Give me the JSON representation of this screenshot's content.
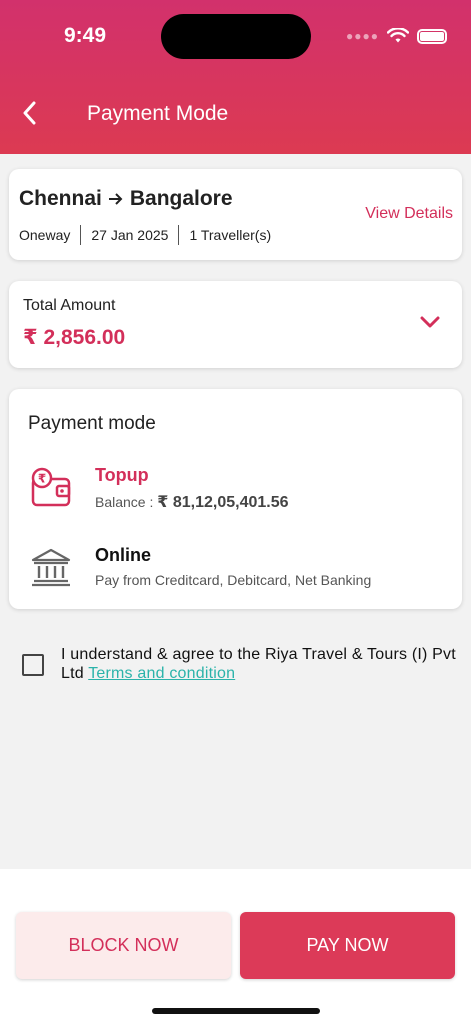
{
  "status_bar": {
    "time": "9:49"
  },
  "header": {
    "title": "Payment Mode"
  },
  "trip": {
    "from": "Chennai",
    "to": "Bangalore",
    "trip_type": "Oneway",
    "date": "27 Jan 2025",
    "travellers": "1 Traveller(s)",
    "view_details_label": "View Details"
  },
  "amount": {
    "label": "Total Amount",
    "value": "₹ 2,856.00"
  },
  "payment_mode": {
    "title": "Payment mode",
    "options": [
      {
        "name": "Topup",
        "balance_label": "Balance :",
        "balance_value": "₹ 81,12,05,401.56",
        "icon": "wallet-icon"
      },
      {
        "name": "Online",
        "sub": "Pay from Creditcard, Debitcard, Net Banking",
        "icon": "bank-icon"
      }
    ]
  },
  "agreement": {
    "text": "I understand & agree to the Riya Travel & Tours (I) Pvt Ltd ",
    "link_label": "Terms and condition",
    "checked": false
  },
  "actions": {
    "block_label": "BLOCK NOW",
    "pay_label": "PAY NOW"
  },
  "colors": {
    "brand": "#d32f5a",
    "header_top": "#d2316c",
    "header_bottom": "#dc3a52",
    "link": "#2bb3aa"
  }
}
